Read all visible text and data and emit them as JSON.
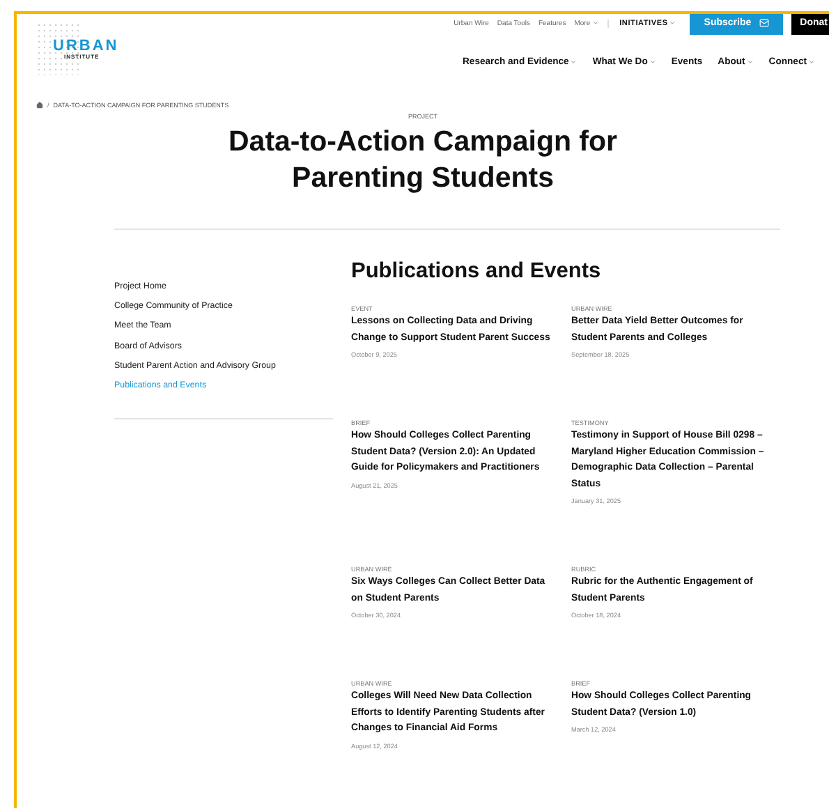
{
  "logo": {
    "name": "URBAN",
    "subtitle": "INSTITUTE"
  },
  "utility_links": [
    {
      "label": "Urban Wire",
      "dropdown": false
    },
    {
      "label": "Data Tools",
      "dropdown": false
    },
    {
      "label": "Features",
      "dropdown": false
    },
    {
      "label": "More",
      "dropdown": true
    }
  ],
  "initiatives": {
    "label": "INITIATIVES"
  },
  "subscribe": {
    "label": "Subscribe"
  },
  "donate": {
    "label": "Donat"
  },
  "main_nav": [
    {
      "label": "Research and Evidence",
      "dropdown": true
    },
    {
      "label": "What We Do",
      "dropdown": true
    },
    {
      "label": "Events",
      "dropdown": false
    },
    {
      "label": "About",
      "dropdown": true
    },
    {
      "label": "Connect",
      "dropdown": true
    }
  ],
  "breadcrumb": {
    "separator": "/",
    "current": "DATA-TO-ACTION CAMPAIGN FOR PARENTING STUDENTS"
  },
  "eyebrow": "PROJECT",
  "title": "Data-to-Action Campaign for Parenting Students",
  "sidebar": {
    "items": [
      {
        "label": "Project Home",
        "selected": false
      },
      {
        "label": "College Community of Practice",
        "selected": false
      },
      {
        "label": "Meet the Team",
        "selected": false
      },
      {
        "label": "Board of Advisors",
        "selected": false
      },
      {
        "label": "Student Parent Action and Advisory Group",
        "selected": false
      },
      {
        "label": "Publications and Events",
        "selected": true
      }
    ]
  },
  "section_title": "Publications and Events",
  "items": [
    {
      "type": "EVENT",
      "title": "Lessons on Collecting Data and Driving Change to Support Student Parent Success",
      "date": "October 9, 2025"
    },
    {
      "type": "URBAN WIRE",
      "title": "Better Data Yield Better Outcomes for Student Parents and Colleges",
      "date": "September 18, 2025"
    },
    {
      "type": "BRIEF",
      "title": "How Should Colleges Collect Parenting Student Data? (Version 2.0): An Updated Guide for Policymakers and Practitioners",
      "date": "August 21, 2025"
    },
    {
      "type": "TESTIMONY",
      "title": "Testimony in Support of House Bill 0298 – Maryland Higher Education Commission – Demographic Data Collection – Parental Status",
      "date": "January 31, 2025"
    },
    {
      "type": "URBAN WIRE",
      "title": "Six Ways Colleges Can Collect Better Data on Student Parents",
      "date": "October 30, 2024"
    },
    {
      "type": "RUBRIC",
      "title": "Rubric for the Authentic Engagement of Student Parents",
      "date": "October 18, 2024"
    },
    {
      "type": "URBAN WIRE",
      "title": "Colleges Will Need New Data Collection Efforts to Identify Parenting Students after Changes to Financial Aid Forms",
      "date": "August 12, 2024"
    },
    {
      "type": "BRIEF",
      "title": "How Should Colleges Collect Parenting Student Data? (Version 1.0)",
      "date": "March 12, 2024"
    }
  ]
}
